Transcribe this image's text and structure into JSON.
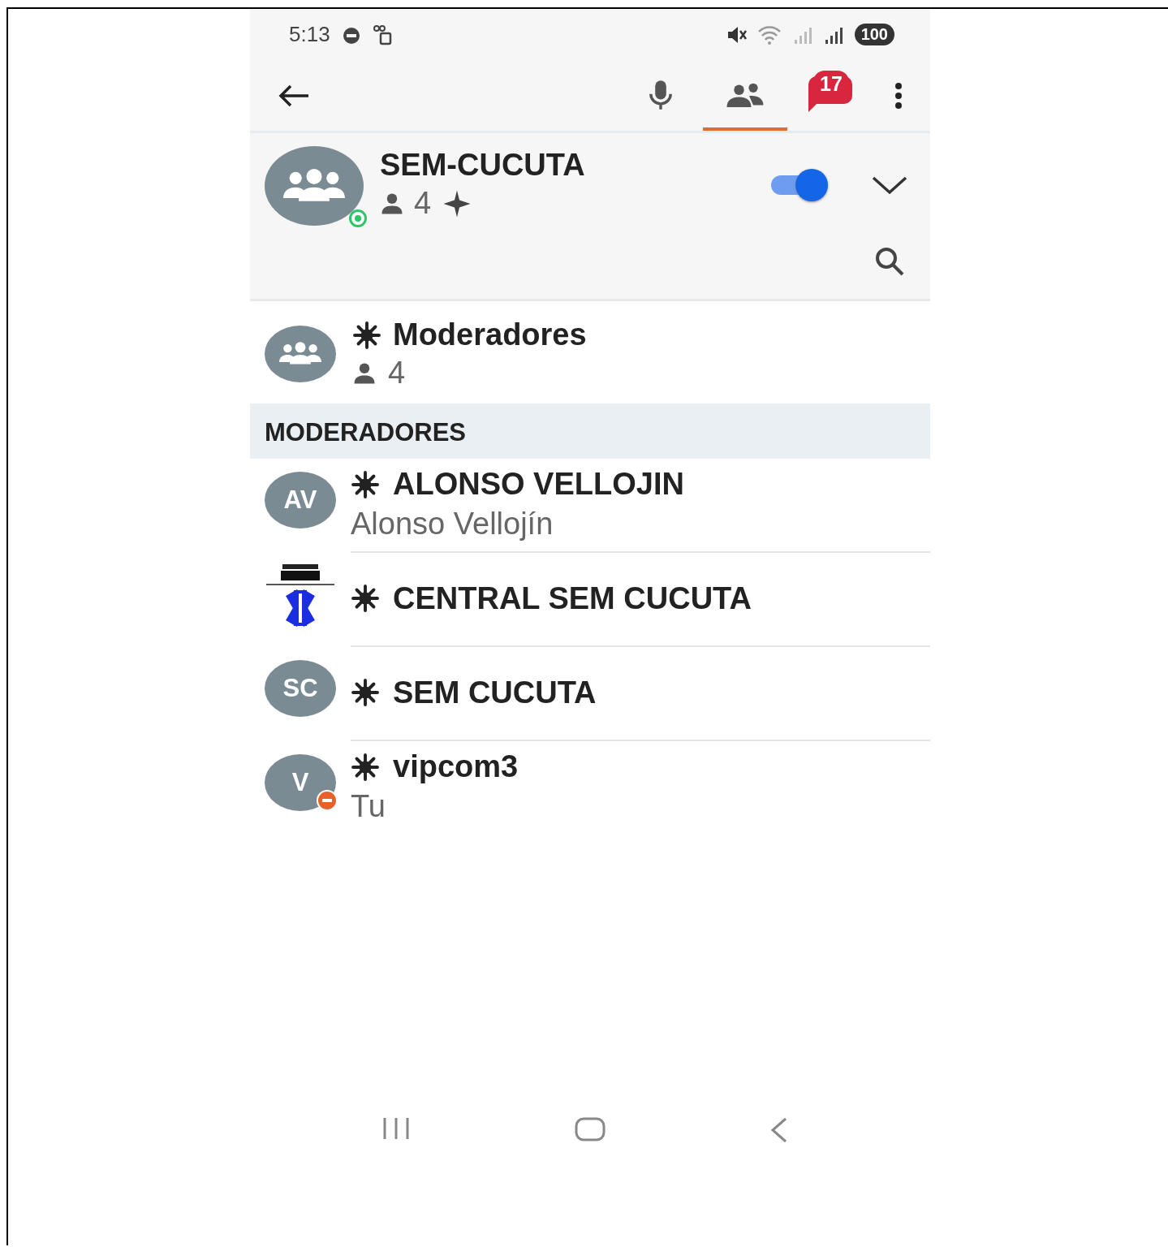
{
  "status_bar": {
    "time": "5:13",
    "battery": "100"
  },
  "toolbar": {
    "tabs": [
      {
        "kind": "voice",
        "selected": false
      },
      {
        "kind": "members",
        "selected": true
      },
      {
        "kind": "chat",
        "selected": false,
        "badge": "17"
      }
    ]
  },
  "channel": {
    "name": "SEM-CUCUTA",
    "member_count": "4",
    "online": true,
    "notifications_on": true
  },
  "groups": [
    {
      "name": "Moderadores",
      "count": "4"
    }
  ],
  "sections": [
    {
      "title": "MODERADORES",
      "members": [
        {
          "kind": "initials",
          "avatar": "AV",
          "name": "ALONSO VELLOJIN",
          "subtitle": "Alonso Vellojín",
          "busy": false
        },
        {
          "kind": "picture",
          "name": "CENTRAL SEM CUCUTA",
          "busy": false
        },
        {
          "kind": "initials",
          "avatar": "SC",
          "name": "SEM CUCUTA",
          "busy": false
        },
        {
          "kind": "initials",
          "avatar": "V",
          "name": "vipcom3",
          "subtitle": "Tu",
          "busy": true
        }
      ]
    }
  ]
}
